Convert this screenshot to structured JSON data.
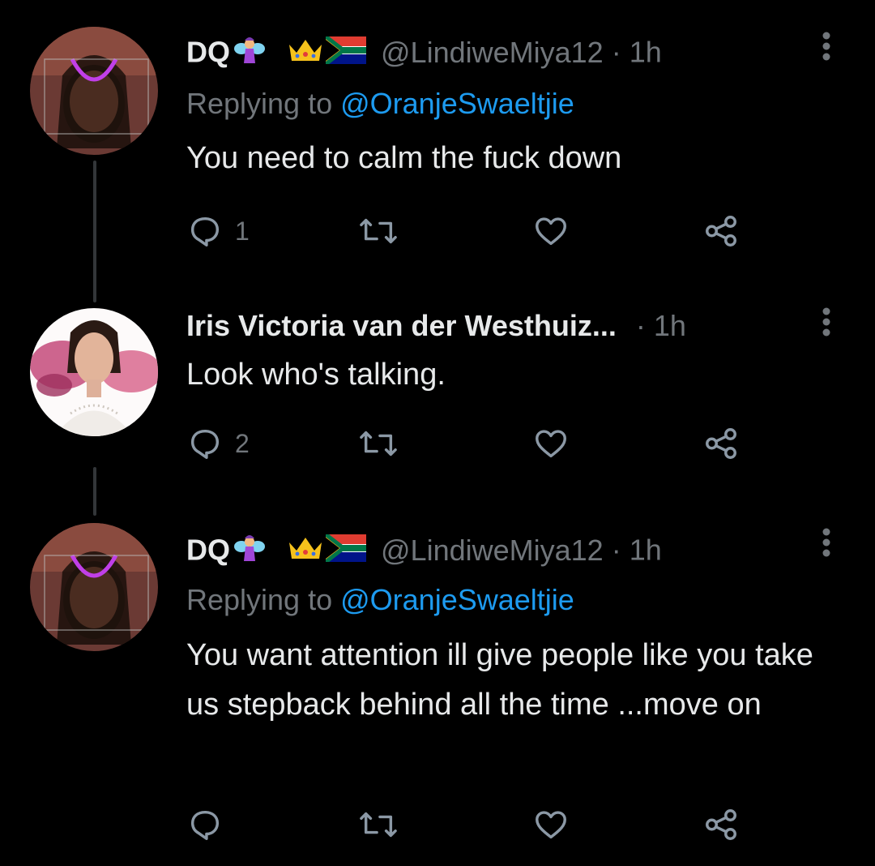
{
  "tweets": [
    {
      "author_name": "DQ",
      "author_handle": "@LindiweMiya12",
      "separator": "·",
      "time": "1h",
      "replying_prefix": "Replying to",
      "replying_to": "@OranjeSwaeltjie",
      "text": "You need to calm the fuck down",
      "reply_count": "1",
      "retweet_count": "",
      "like_count": ""
    },
    {
      "author_name": "Iris Victoria van der Westhuiz...",
      "author_handle": "",
      "separator": "·",
      "time": "1h",
      "text": "Look who's talking.",
      "reply_count": "2",
      "retweet_count": "",
      "like_count": ""
    },
    {
      "author_name": "DQ",
      "author_handle": "@LindiweMiya12",
      "separator": "·",
      "time": "1h",
      "replying_prefix": "Replying to",
      "replying_to": "@OranjeSwaeltjie",
      "text": "You want attention ill give people like you take us stepback behind all the time ...move on",
      "reply_count": "",
      "retweet_count": "",
      "like_count": ""
    }
  ],
  "icons": {
    "name_emojis": [
      "fairy-emoji",
      "crown-emoji",
      "south-africa-flag-emoji"
    ],
    "reply": "reply-icon",
    "retweet": "retweet-icon",
    "like": "heart-icon",
    "share": "share-icon",
    "more": "more-vertical-icon"
  },
  "colors": {
    "background": "#000000",
    "text_primary": "#e7e9ea",
    "text_secondary": "#71767b",
    "link": "#1d9bf0",
    "thread_line": "#333639"
  }
}
